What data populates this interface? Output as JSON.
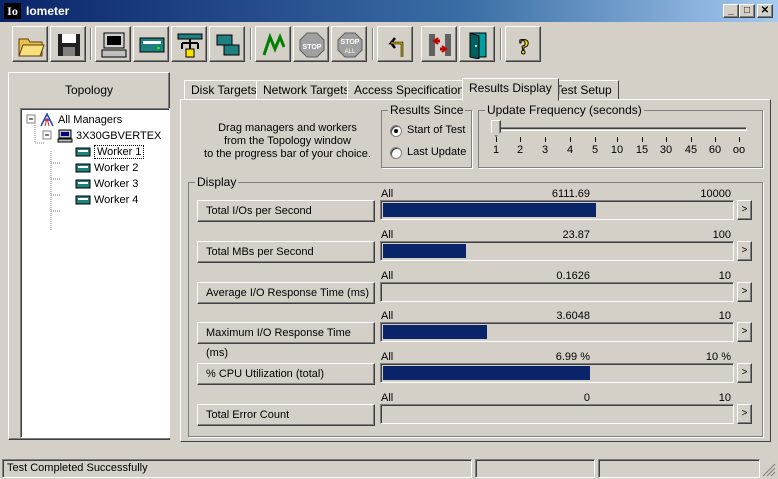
{
  "window": {
    "title": "Iometer",
    "app_icon_text": "Io",
    "minimize": "_",
    "maximize": "□",
    "close": "✕"
  },
  "toolbar": {
    "buttons": [
      "open-config",
      "save-config",
      "new-disk-worker",
      "new-network-worker",
      "start-new-manager",
      "duplicate-worker",
      "start-tests",
      "stop-current",
      "stop-all",
      "reset-workers",
      "exit-managers",
      "abort-all",
      "help"
    ],
    "stop_label": "STOP",
    "stop_all_top": "STOP",
    "stop_all_bottom": "ALL",
    "help_label": "?"
  },
  "topology": {
    "title": "Topology",
    "root": "All Managers",
    "manager": "3X30GBVERTEX",
    "workers": [
      "Worker 1",
      "Worker 2",
      "Worker 3",
      "Worker 4"
    ],
    "selected_worker": "Worker 1"
  },
  "tabs": [
    "Disk Targets",
    "Network Targets",
    "Access Specifications",
    "Results Display",
    "Test Setup"
  ],
  "active_tab": "Results Display",
  "instructions": [
    "Drag managers and workers",
    "from the Topology window",
    "to the progress bar of your choice."
  ],
  "results_since": {
    "title": "Results Since",
    "options": [
      "Start of Test",
      "Last Update"
    ],
    "selected": "Start of Test"
  },
  "update_frequency": {
    "title": "Update Frequency (seconds)",
    "ticks": [
      "1",
      "2",
      "3",
      "4",
      "5",
      "10",
      "15",
      "30",
      "45",
      "60",
      "oo"
    ],
    "value": "1"
  },
  "display": {
    "title": "Display",
    "metrics": [
      {
        "label": "Total I/Os per Second",
        "source": "All Managers",
        "value": "6111.69",
        "max": "10000",
        "fill": 0.611,
        "arrow": ">"
      },
      {
        "label": "Total MBs per Second",
        "source": "All Managers",
        "value": "23.87",
        "max": "100",
        "fill": 0.2387,
        "arrow": ">"
      },
      {
        "label": "Average I/O Response Time (ms)",
        "source": "All Managers",
        "value": "0.1626",
        "max": "10",
        "fill": 0.0,
        "arrow": ">"
      },
      {
        "label": "Maximum I/O Response Time (ms)",
        "source": "All Managers",
        "value": "3.6048",
        "max": "10",
        "fill": 0.3,
        "arrow": ">"
      },
      {
        "label": "% CPU Utilization (total)",
        "source": "All Managers",
        "value": "6.99 %",
        "max": "10 %",
        "fill": 0.595,
        "arrow": ">"
      },
      {
        "label": "Total Error Count",
        "source": "All Managers",
        "value": "0",
        "max": "10",
        "fill": 0.0,
        "arrow": ">"
      }
    ]
  },
  "status": {
    "message": "Test Completed Successfully"
  }
}
